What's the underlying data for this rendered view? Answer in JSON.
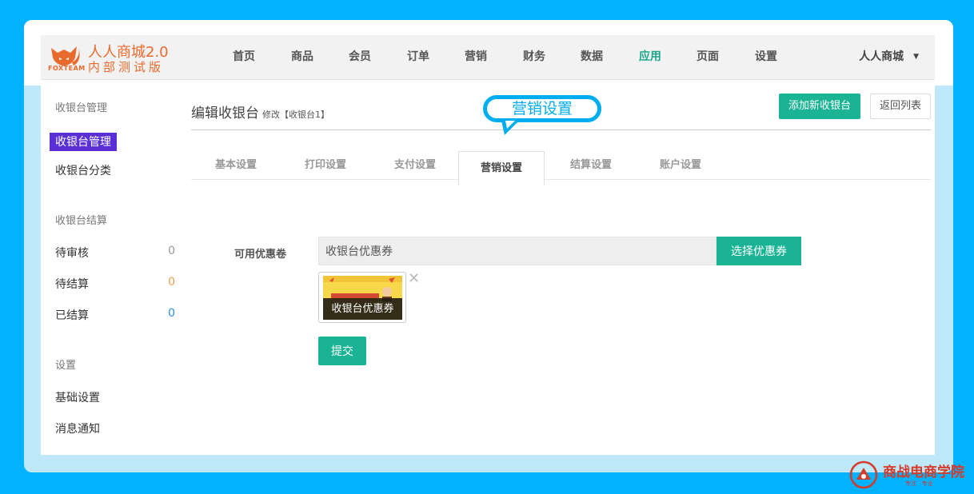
{
  "brand": {
    "team": "FOXTEAM",
    "title": "人人商城2.0",
    "subtitle": "内部测试版"
  },
  "nav": {
    "items": [
      "首页",
      "商品",
      "会员",
      "订单",
      "营销",
      "财务",
      "数据",
      "应用",
      "页面",
      "设置"
    ],
    "active": "应用",
    "user_label": "人人商城"
  },
  "sidebar": {
    "group1": "收银台管理",
    "link_manage": "收银台管理",
    "link_category": "收银台分类",
    "group2": "收银台结算",
    "pending_review": {
      "label": "待审核",
      "count": "0"
    },
    "pending_settle": {
      "label": "待结算",
      "count": "0"
    },
    "settled": {
      "label": "已结算",
      "count": "0"
    },
    "group3": "设置",
    "link_basic": "基础设置",
    "link_notify": "消息通知"
  },
  "main": {
    "title": "编辑收银台",
    "subtitle": "修改【收银台1】",
    "add_button": "添加新收银台",
    "back_button": "返回列表",
    "callout": "营销设置",
    "tabs": [
      "基本设置",
      "打印设置",
      "支付设置",
      "营销设置",
      "结算设置",
      "账户设置"
    ],
    "active_tab": "营销设置",
    "coupon_label": "可用优惠卷",
    "coupon_value": "收银台优惠券",
    "select_button": "选择优惠券",
    "coupon_card_caption": "收银台优惠券",
    "remove_symbol": "✕",
    "submit_button": "提交"
  },
  "watermark": {
    "text": "商战电商学院",
    "sub": "专注 · 专业"
  },
  "colors": {
    "outer_bg": "#00b2ff",
    "accent_green": "#1ab394",
    "active_side": "#5b2fd6",
    "brand_orange": "#e86a2c",
    "callout_blue": "#00aef0"
  }
}
